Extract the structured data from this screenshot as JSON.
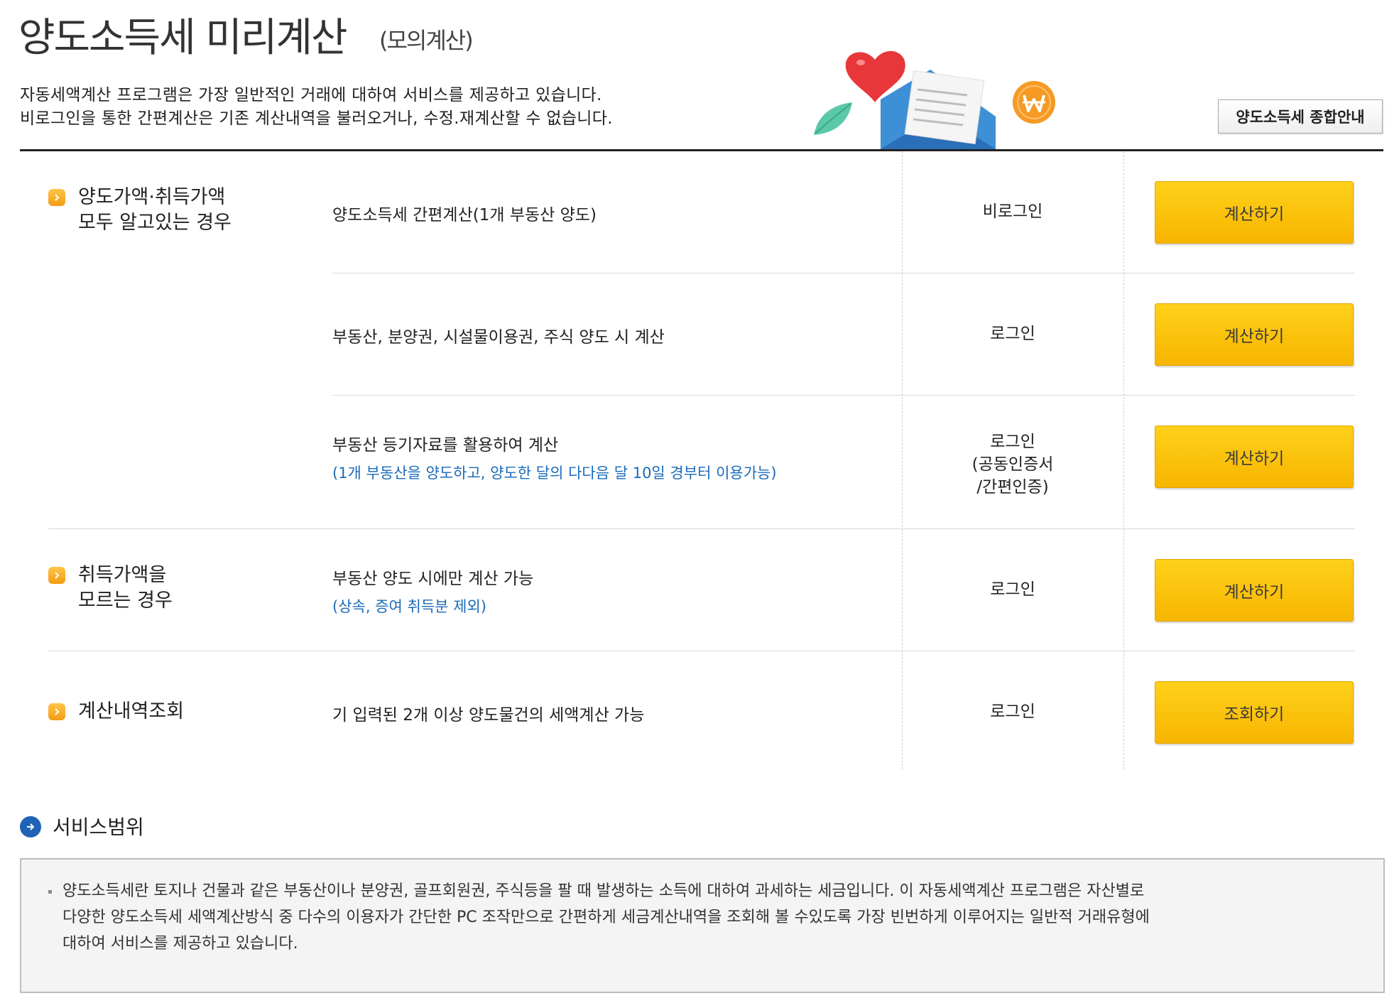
{
  "header": {
    "title": "양도소득세 미리계산",
    "subtitle": "(모의계산)",
    "desc_line1": "자동세액계산 프로그램은 가장 일반적인 거래에 대하여 서비스를 제공하고 있습니다.",
    "desc_line2": "비로그인을 통한 간편계산은 기존 계산내역을 불러오거나, 수정.재계산할 수 없습니다.",
    "guide_button": "양도소득세 종합안내"
  },
  "categories": [
    {
      "line1": "양도가액·취득가액",
      "line2": "모두 알고있는 경우"
    },
    {
      "line1": "취득가액을",
      "line2": "모르는 경우"
    },
    {
      "line1": "계산내역조회",
      "line2": ""
    }
  ],
  "rows": [
    {
      "service": "양도소득세 간편계산(1개 부동산 양도)",
      "note": "",
      "login": [
        "비로그인"
      ],
      "button": "계산하기"
    },
    {
      "service": "부동산, 분양권, 시설물이용권, 주식 양도 시 계산",
      "note": "",
      "login": [
        "로그인"
      ],
      "button": "계산하기"
    },
    {
      "service": "부동산 등기자료를 활용하여 계산",
      "note": "(1개 부동산을 양도하고, 양도한 달의 다다음 달 10일 경부터 이용가능)",
      "login": [
        "로그인",
        "(공동인증서",
        "/간편인증)"
      ],
      "button": "계산하기"
    },
    {
      "service": "부동산 양도 시에만 계산 가능",
      "note": "(상속, 증여 취득분 제외)",
      "login": [
        "로그인"
      ],
      "button": "계산하기"
    },
    {
      "service": "기 입력된 2개 이상 양도물건의 세액계산 가능",
      "note": "",
      "login": [
        "로그인"
      ],
      "button": "조회하기"
    }
  ],
  "service_range": {
    "title": "서비스범위",
    "lines": [
      "양도소득세란 토지나 건물과 같은 부동산이나 분양권, 골프회원권, 주식등을 팔 때 발생하는 소득에 대하여 과세하는 세금입니다. 이 자동세액계산 프로그램은 자산별로",
      "다양한 양도소득세 세액계산방식 중 다수의 이용자가 간단한 PC 조작만으로 간편하게 세금계산내역을 조회해 볼 수있도록 가장 빈번하게 이루어지는 일반적 거래유형에",
      "대하여 서비스를 제공하고 있습니다."
    ]
  },
  "icons": {
    "category": "chevron-right-icon",
    "section": "arrow-right-circle-icon",
    "illustration": [
      "heart-icon",
      "leaf-icon",
      "envelope-icon",
      "won-coin-icon"
    ]
  },
  "colors": {
    "button": "#f7b500",
    "note": "#1a6bb8",
    "section_icon": "#1e63b5",
    "category_icon": "#f39c12"
  }
}
